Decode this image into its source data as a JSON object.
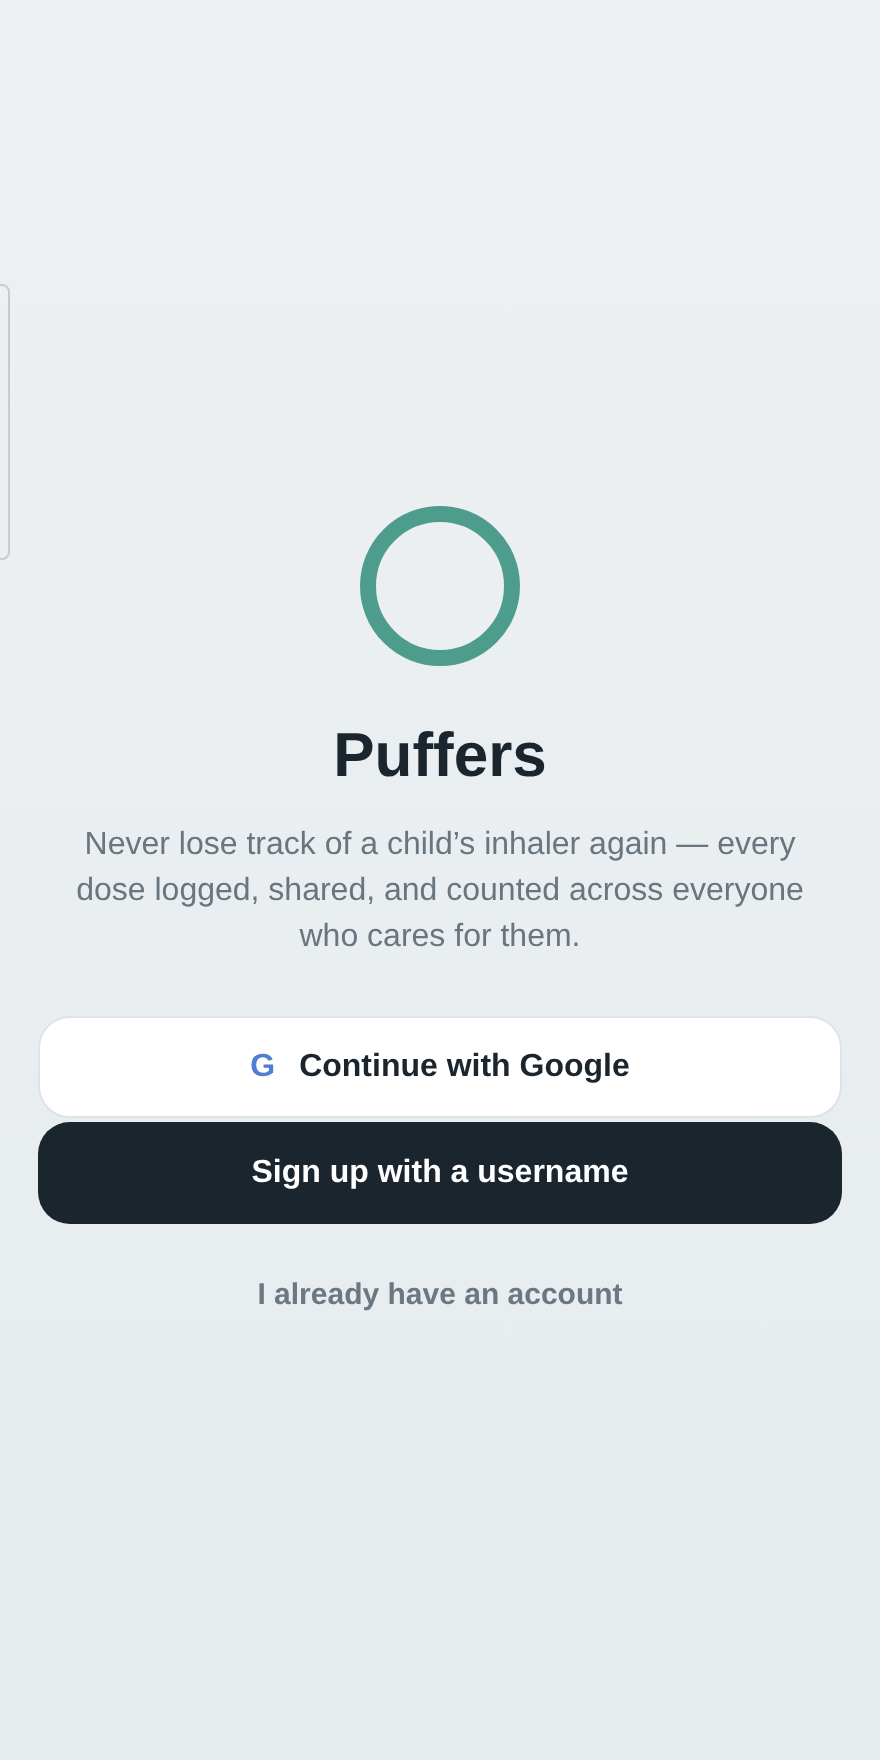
{
  "app": {
    "title": "Puffers",
    "tagline": "Never lose track of a child’s inhaler again — every dose logged, shared, and counted across everyone who cares for them."
  },
  "buttons": [
    {
      "kind": "outline",
      "icon_text": "G",
      "label": "Continue with Google"
    },
    {
      "kind": "solid",
      "label": "Sign up with a username"
    }
  ],
  "link": {
    "label": "I already have an account"
  }
}
